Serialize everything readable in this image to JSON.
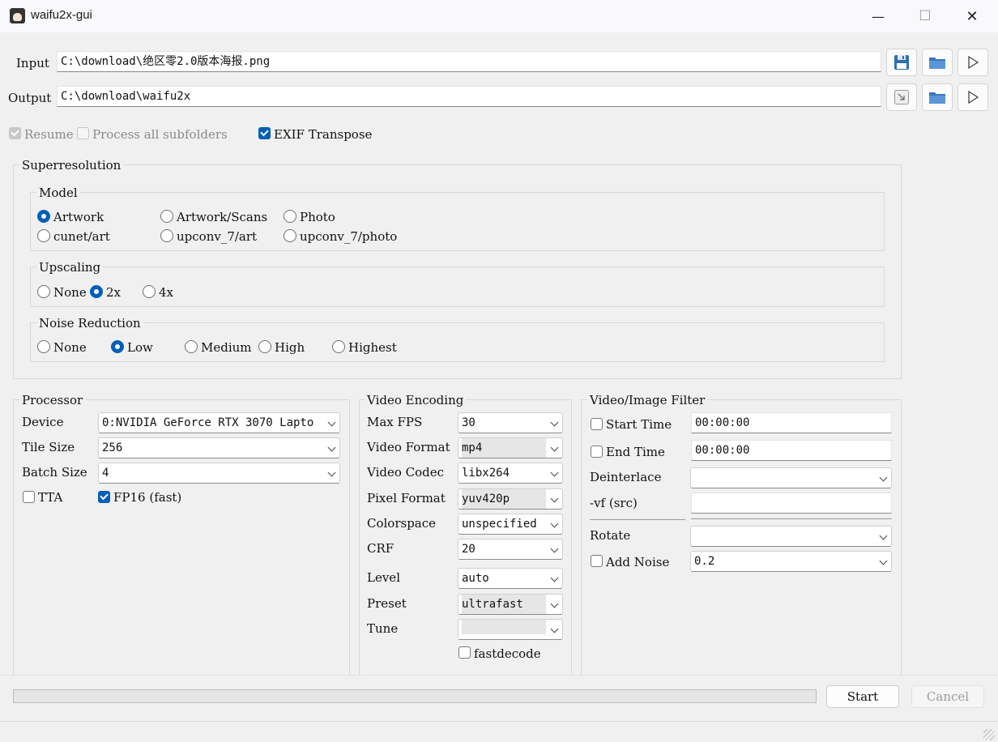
{
  "window": {
    "title": "waifu2x-gui",
    "minimize": "—",
    "maximize": "☐",
    "close": "✕"
  },
  "io": {
    "input_label": "Input",
    "input_value": "C:\\download\\绝区零2.0版本海报.png",
    "output_label": "Output",
    "output_value": "C:\\download\\waifu2x"
  },
  "options": {
    "resume": "Resume",
    "process_subfolders": "Process all subfolders",
    "exif_transpose": "EXIF Transpose"
  },
  "superres": {
    "title": "Superresolution",
    "model": {
      "title": "Model",
      "options": [
        "Artwork",
        "Artwork/Scans",
        "Photo",
        "cunet/art",
        "upconv_7/art",
        "upconv_7/photo"
      ],
      "selected": "Artwork"
    },
    "upscaling": {
      "title": "Upscaling",
      "options": [
        "None",
        "2x",
        "4x"
      ],
      "selected": "2x"
    },
    "noise": {
      "title": "Noise Reduction",
      "options": [
        "None",
        "Low",
        "Medium",
        "High",
        "Highest"
      ],
      "selected": "Low"
    }
  },
  "processor": {
    "title": "Processor",
    "device_label": "Device",
    "device_value": "0:NVIDIA GeForce RTX 3070 Lapto",
    "tile_label": "Tile Size",
    "tile_value": "256",
    "batch_label": "Batch Size",
    "batch_value": "4",
    "tta": "TTA",
    "fp16": "FP16 (fast)"
  },
  "video": {
    "title": "Video Encoding",
    "fields": [
      {
        "label": "Max FPS",
        "value": "30"
      },
      {
        "label": "Video Format",
        "value": "mp4"
      },
      {
        "label": "Video Codec",
        "value": "libx264"
      },
      {
        "label": "Pixel Format",
        "value": "yuv420p"
      },
      {
        "label": "Colorspace",
        "value": "unspecified"
      },
      {
        "label": "CRF",
        "value": "20"
      },
      {
        "label": "Level",
        "value": "auto"
      },
      {
        "label": "Preset",
        "value": "ultrafast"
      },
      {
        "label": "Tune",
        "value": ""
      }
    ],
    "fastdecode": "fastdecode"
  },
  "filter": {
    "title": "Video/Image Filter",
    "start_time_label": "Start Time",
    "start_time_value": "00:00:00",
    "end_time_label": "End Time",
    "end_time_value": "00:00:00",
    "deinterlace_label": "Deinterlace",
    "deinterlace_value": "",
    "vf_label": "-vf (src)",
    "vf_value": "",
    "rotate_label": "Rotate",
    "rotate_value": "",
    "add_noise_label": "Add Noise",
    "add_noise_value": "0.2"
  },
  "actions": {
    "start": "Start",
    "cancel": "Cancel",
    "progress": 0
  },
  "colors": {
    "accent": "#005fb8",
    "window_bg": "#f0f0f0"
  }
}
